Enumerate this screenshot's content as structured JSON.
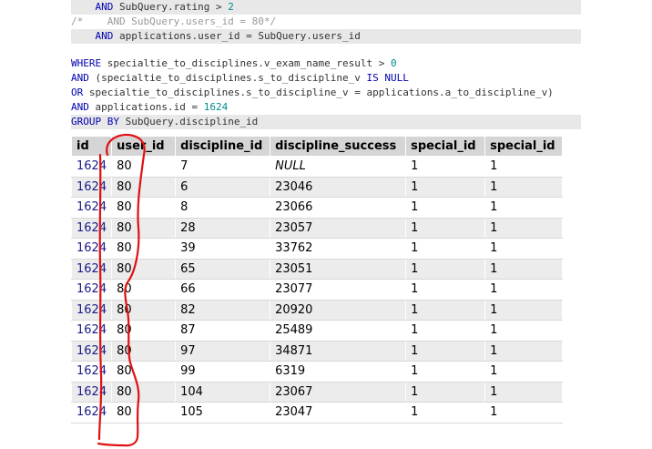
{
  "sql": {
    "lines": [
      {
        "parts": [
          {
            "t": "    ",
            "c": ""
          },
          {
            "t": "AND",
            "c": "kw"
          },
          {
            "t": " SubQuery.rating > ",
            "c": ""
          },
          {
            "t": "2",
            "c": "num"
          }
        ],
        "hl": true
      },
      {
        "parts": [
          {
            "t": "/*    AND SubQuery.users_id = 80*/",
            "c": "cmt"
          }
        ],
        "hl": false
      },
      {
        "parts": [
          {
            "t": "    ",
            "c": ""
          },
          {
            "t": "AND",
            "c": "kw"
          },
          {
            "t": " applications.user_id = SubQuery.users_id",
            "c": ""
          }
        ],
        "hl": true
      },
      {
        "parts": [],
        "hl": false,
        "blank": true
      },
      {
        "parts": [
          {
            "t": "WHERE",
            "c": "kw"
          },
          {
            "t": " specialtie_to_disciplines.v_exam_name_result > ",
            "c": ""
          },
          {
            "t": "0",
            "c": "num"
          }
        ],
        "hl": false
      },
      {
        "parts": [
          {
            "t": "AND",
            "c": "kw"
          },
          {
            "t": " (specialtie_to_disciplines.s_to_discipline_v ",
            "c": ""
          },
          {
            "t": "IS NULL",
            "c": "kw"
          }
        ],
        "hl": false
      },
      {
        "parts": [
          {
            "t": "OR",
            "c": "kw"
          },
          {
            "t": " specialtie_to_disciplines.s_to_discipline_v = applications.a_to_discipline_v)",
            "c": ""
          }
        ],
        "hl": false
      },
      {
        "parts": [
          {
            "t": "AND",
            "c": "kw"
          },
          {
            "t": " applications.id = ",
            "c": ""
          },
          {
            "t": "1624",
            "c": "num"
          }
        ],
        "hl": false
      },
      {
        "parts": [
          {
            "t": "GROUP BY",
            "c": "kw"
          },
          {
            "t": " SubQuery.discipline_id",
            "c": ""
          }
        ],
        "hl": true
      }
    ]
  },
  "results": {
    "columns": [
      "id",
      "user_id",
      "discipline_id",
      "discipline_success",
      "special_id",
      "special_id"
    ],
    "rows": [
      [
        "1624",
        "80",
        "7",
        "NULL",
        "1",
        "1"
      ],
      [
        "1624",
        "80",
        "6",
        "23046",
        "1",
        "1"
      ],
      [
        "1624",
        "80",
        "8",
        "23066",
        "1",
        "1"
      ],
      [
        "1624",
        "80",
        "28",
        "23057",
        "1",
        "1"
      ],
      [
        "1624",
        "80",
        "39",
        "33762",
        "1",
        "1"
      ],
      [
        "1624",
        "80",
        "65",
        "23051",
        "1",
        "1"
      ],
      [
        "1624",
        "80",
        "66",
        "23077",
        "1",
        "1"
      ],
      [
        "1624",
        "80",
        "82",
        "20920",
        "1",
        "1"
      ],
      [
        "1624",
        "80",
        "87",
        "25489",
        "1",
        "1"
      ],
      [
        "1624",
        "80",
        "97",
        "34871",
        "1",
        "1"
      ],
      [
        "1624",
        "80",
        "99",
        "6319",
        "1",
        "1"
      ],
      [
        "1624",
        "80",
        "104",
        "23067",
        "1",
        "1"
      ],
      [
        "1624",
        "80",
        "105",
        "23047",
        "1",
        "1"
      ]
    ]
  },
  "annotation": {
    "color": "#e01010"
  }
}
